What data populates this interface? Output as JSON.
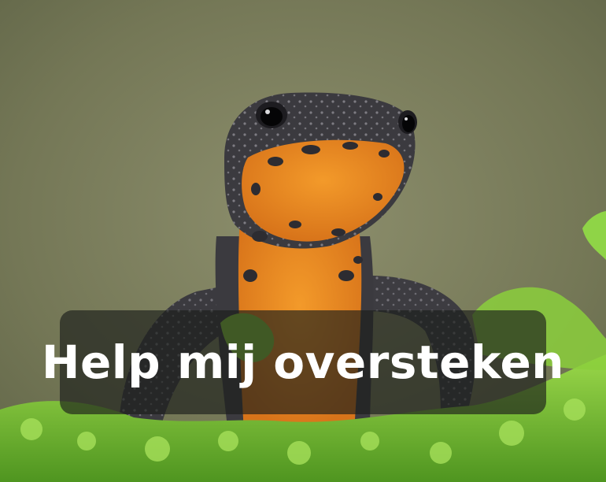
{
  "caption": {
    "text": "Help mij oversteken"
  },
  "photo": {
    "subject": "newt",
    "colors": {
      "belly": "#e8891e",
      "skin": "#3b3a3f",
      "moss": "#7fc433",
      "background": "#7d8060"
    }
  }
}
